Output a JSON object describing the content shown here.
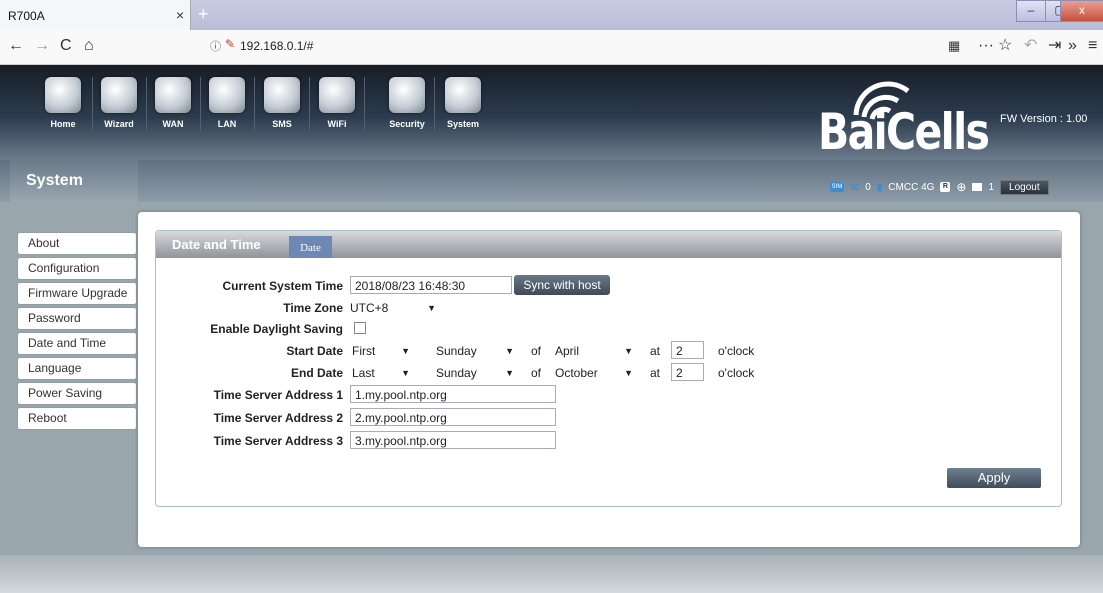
{
  "browser": {
    "tab_title": "R700A",
    "tab_close": "×",
    "new_tab": "+",
    "url": "192.168.0.1/#",
    "nav_back": "←",
    "nav_forward": "→",
    "nav_reload": "C",
    "nav_home": "⌂",
    "menu_dots": "···",
    "bookmark": "☆",
    "overflow": "»",
    "hamburger": "≡",
    "win_min": "–",
    "win_max": "▢",
    "win_close": "x"
  },
  "banner": {
    "nav": [
      {
        "label": "Home",
        "icon": "home-icon"
      },
      {
        "label": "Wizard",
        "icon": "wizard-icon"
      },
      {
        "label": "WAN",
        "icon": "wan-icon"
      },
      {
        "label": "LAN",
        "icon": "lan-icon"
      },
      {
        "label": "SMS",
        "icon": "sms-icon"
      },
      {
        "label": "WiFi",
        "icon": "wifi-icon"
      },
      {
        "label": "Security",
        "icon": "security-icon"
      },
      {
        "label": "System",
        "icon": "system-icon"
      }
    ],
    "logo": "BaiCells",
    "fw_version": "FW Version : 1.00"
  },
  "status": {
    "section_title": "System",
    "sms_count": "0",
    "carrier": "CMCC 4G",
    "msg_count": "1",
    "logout": "Logout"
  },
  "sidebar": {
    "items": [
      "About",
      "Configuration",
      "Firmware Upgrade",
      "Password",
      "Date and Time",
      "Language",
      "Power Saving",
      "Reboot"
    ]
  },
  "panel": {
    "title": "Date and Time",
    "tab": "Date",
    "current_time_label": "Current System Time",
    "current_time_value": "2018/08/23 16:48:30",
    "sync_button": "Sync with host",
    "timezone_label": "Time Zone",
    "timezone_value": "UTC+8",
    "dst_label": "Enable Daylight Saving",
    "start_label": "Start Date",
    "start_week": "First",
    "start_day": "Sunday",
    "start_month": "April",
    "start_hour": "2",
    "end_label": "End Date",
    "end_week": "Last",
    "end_day": "Sunday",
    "end_month": "October",
    "end_hour": "2",
    "of_text": "of",
    "at_text": "at",
    "oclock_text": "o'clock",
    "server1_label": "Time Server Address 1",
    "server1_value": "1.my.pool.ntp.org",
    "server2_label": "Time Server Address 2",
    "server2_value": "2.my.pool.ntp.org",
    "server3_label": "Time Server Address 3",
    "server3_value": "3.my.pool.ntp.org",
    "apply_button": "Apply"
  },
  "colors": {
    "accent": "#6e88b4",
    "button": "#3e4a57"
  }
}
